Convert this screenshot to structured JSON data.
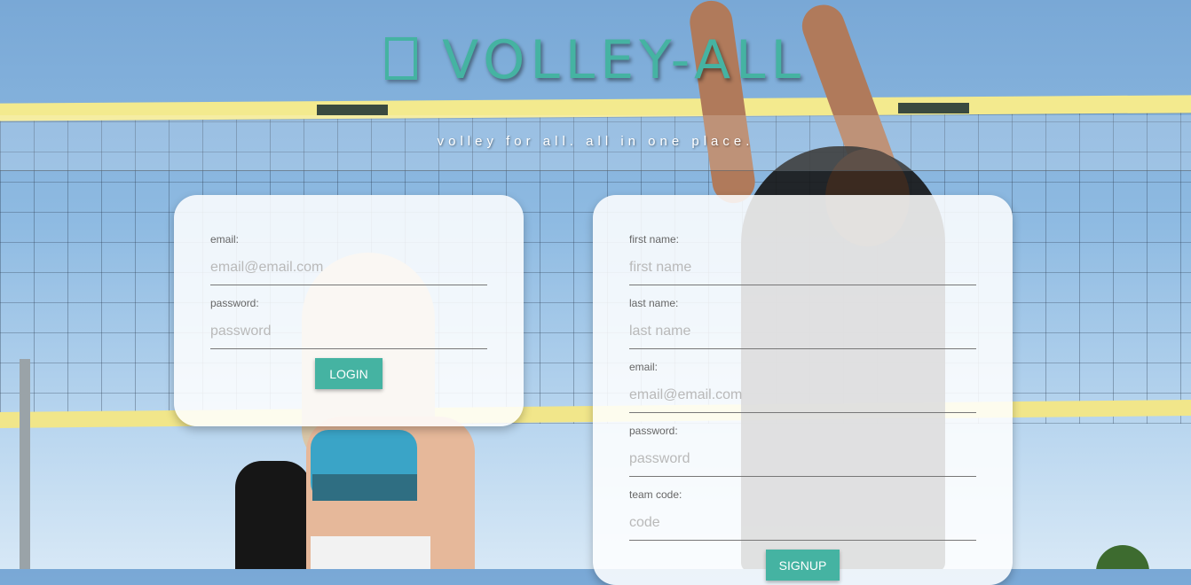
{
  "header": {
    "title": "VOLLEY-ALL",
    "subtitle": "volley for all. all in one place."
  },
  "login": {
    "email_label": "email:",
    "email_placeholder": "email@email.com",
    "password_label": "password:",
    "password_placeholder": "password",
    "button_label": "LOGIN"
  },
  "signup": {
    "first_name_label": "first name:",
    "first_name_placeholder": "first name",
    "last_name_label": "last name:",
    "last_name_placeholder": "last name",
    "email_label": "email:",
    "email_placeholder": "email@email.com",
    "password_label": "password:",
    "password_placeholder": "password",
    "team_code_label": "team code:",
    "team_code_placeholder": "code",
    "button_label": "SIGNUP"
  },
  "colors": {
    "accent": "#45b3a2",
    "card_background": "#ffffff"
  },
  "icons": {
    "title_glyph": "missing-glyph-box-icon"
  }
}
